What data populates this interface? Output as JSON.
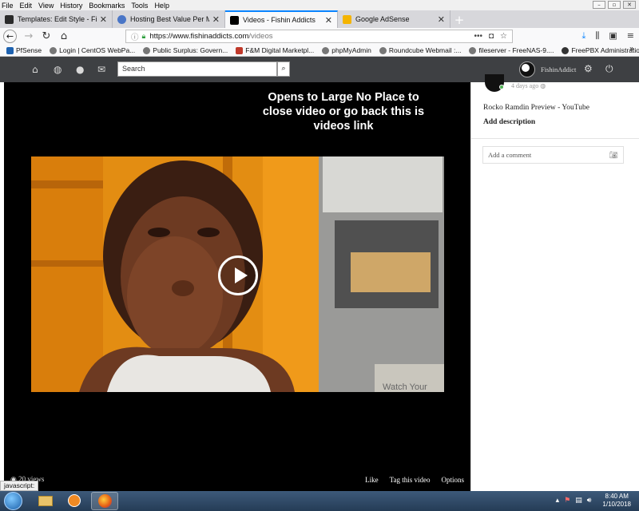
{
  "menubar": [
    "File",
    "Edit",
    "View",
    "History",
    "Bookmarks",
    "Tools",
    "Help"
  ],
  "tabs": [
    {
      "title": "Templates: Edit Style - Fishin A",
      "icon_color": "#2b2b2b"
    },
    {
      "title": "Hosting Best Value Per Money |",
      "icon_color": "#4a76c7"
    },
    {
      "title": "Videos - Fishin Addicts",
      "icon_color": "#000000"
    },
    {
      "title": "Google AdSense",
      "icon_color": "#f4b400"
    }
  ],
  "url": {
    "host": "https://www.fishinaddicts.com",
    "path": "/videos"
  },
  "bookmarks": [
    "PfSense",
    "Login | CentOS WebPa...",
    "Public Surplus: Govern...",
    "F&M Digital Marketpl...",
    "phpMyAdmin",
    "Roundcube Webmail :...",
    "fileserver - FreeNAS-9....",
    "FreePBX Administration"
  ],
  "site": {
    "search_placeholder": "Search",
    "username": "FishinAddict"
  },
  "video": {
    "overlay_note": "Opens to Large No Place to close video or go back this is videos link",
    "views": "20 views",
    "actions": [
      "Like",
      "Tag this video",
      "Options"
    ],
    "truck_text": "Watch Your"
  },
  "panel": {
    "time_ago": "4 days ago",
    "video_title": "Rocko Ramdin Preview - YouTube",
    "add_description": "Add description",
    "comment_placeholder": "Add a comment"
  },
  "status_text": "javascript:",
  "clock": {
    "time": "8:40 AM",
    "date": "1/10/2018"
  },
  "colors": {
    "accent": "#0a84ff",
    "header": "#3e4043",
    "online": "#4caf50"
  }
}
